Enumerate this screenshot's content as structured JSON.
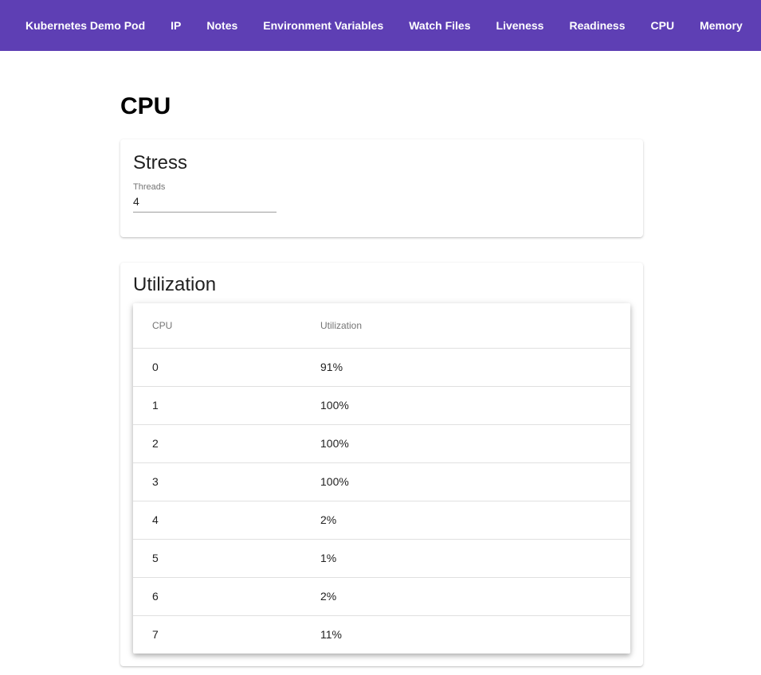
{
  "nav": {
    "items": [
      {
        "label": "Kubernetes Demo Pod"
      },
      {
        "label": "IP"
      },
      {
        "label": "Notes"
      },
      {
        "label": "Environment Variables"
      },
      {
        "label": "Watch Files"
      },
      {
        "label": "Liveness"
      },
      {
        "label": "Readiness"
      },
      {
        "label": "CPU"
      },
      {
        "label": "Memory"
      }
    ]
  },
  "colors": {
    "app_bar": "#5e3fb4"
  },
  "page": {
    "title": "CPU"
  },
  "stress": {
    "title": "Stress",
    "threads_label": "Threads",
    "threads_value": "4"
  },
  "utilization": {
    "title": "Utilization",
    "columns": [
      "CPU",
      "Utilization"
    ],
    "rows": [
      {
        "cpu": "0",
        "util": "91%"
      },
      {
        "cpu": "1",
        "util": "100%"
      },
      {
        "cpu": "2",
        "util": "100%"
      },
      {
        "cpu": "3",
        "util": "100%"
      },
      {
        "cpu": "4",
        "util": "2%"
      },
      {
        "cpu": "5",
        "util": "1%"
      },
      {
        "cpu": "6",
        "util": "2%"
      },
      {
        "cpu": "7",
        "util": "11%"
      }
    ]
  }
}
